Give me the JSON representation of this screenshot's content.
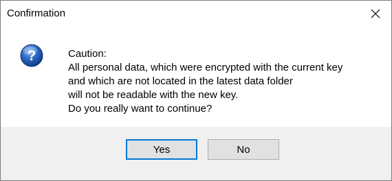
{
  "window": {
    "title": "Confirmation",
    "close_glyph": "×"
  },
  "message": {
    "lines": [
      "Caution:",
      "All personal data, which were encrypted with the current key",
      "and which are not located in the latest data folder",
      "will not be readable with the new key.",
      "Do you really want to continue?"
    ]
  },
  "icon": {
    "name": "question-icon",
    "glyph": "?",
    "color": "#1f5fbf"
  },
  "buttons": {
    "yes_label": "Yes",
    "no_label": "No",
    "default_focus_color": "#0078d7"
  }
}
